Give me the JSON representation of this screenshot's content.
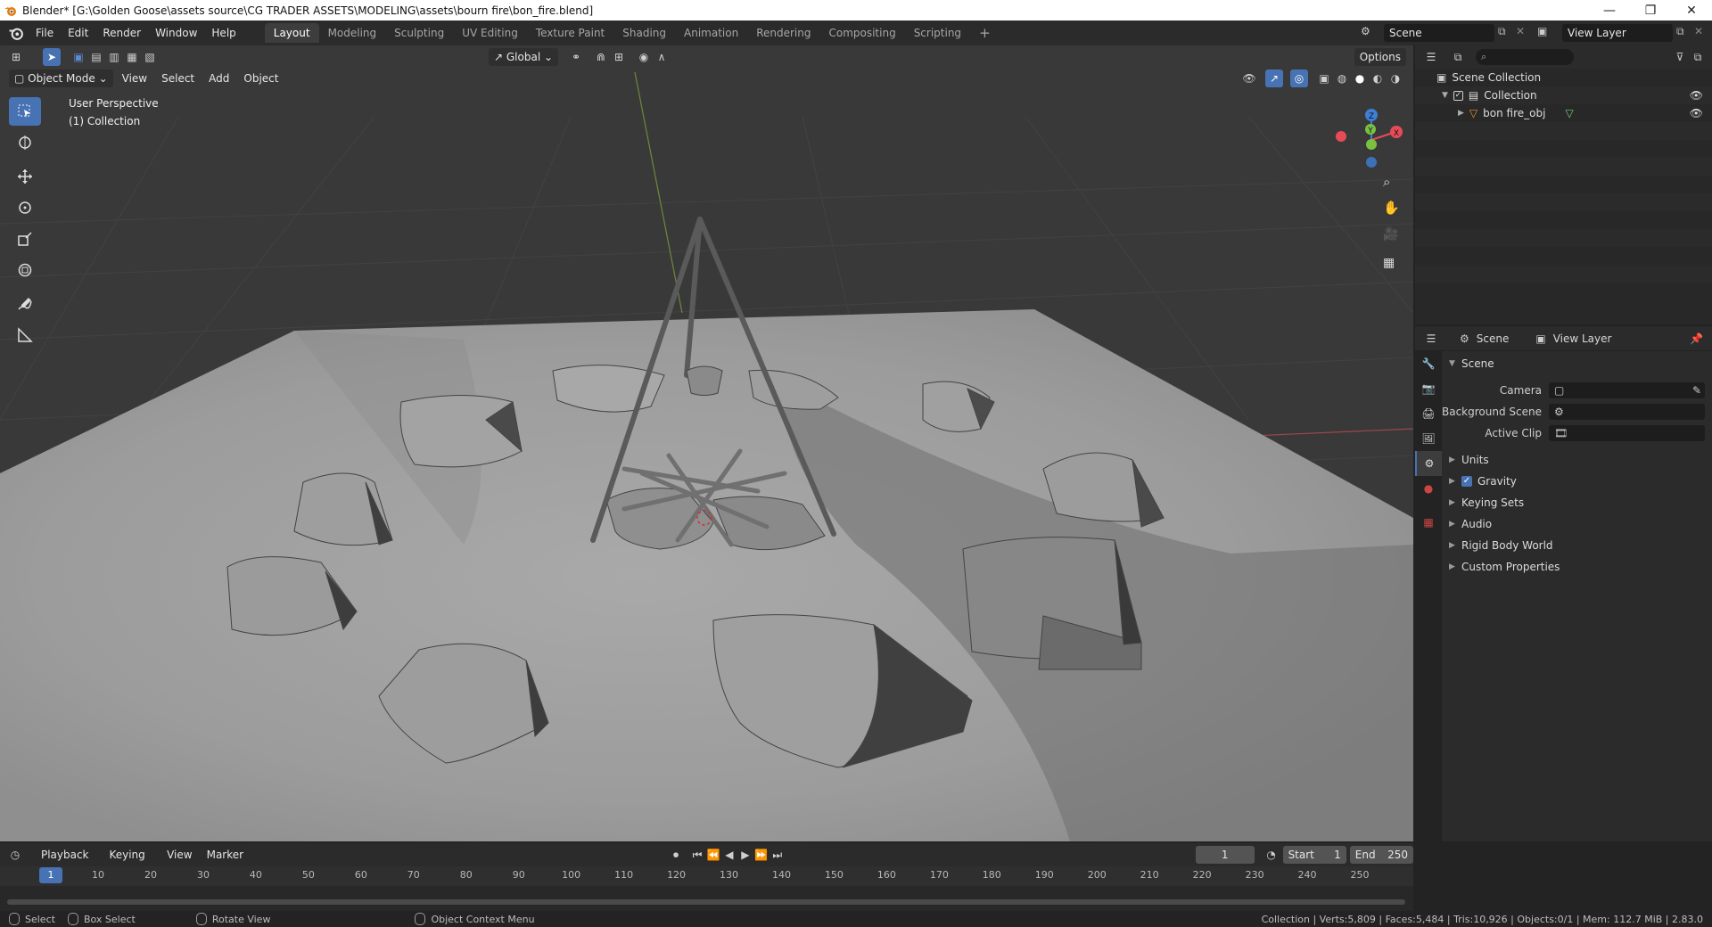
{
  "window": {
    "title": "Blender* [G:\\Golden Goose\\assets source\\CG TRADER ASSETS\\MODELING\\assets\\bourn fire\\bon_fire.blend]",
    "controls": [
      "—",
      "❐",
      "✕"
    ]
  },
  "menu": [
    "File",
    "Edit",
    "Render",
    "Window",
    "Help"
  ],
  "workspaces": [
    "Layout",
    "Modeling",
    "Sculpting",
    "UV Editing",
    "Texture Paint",
    "Shading",
    "Animation",
    "Rendering",
    "Compositing",
    "Scripting"
  ],
  "active_workspace": "Layout",
  "add_workspace": "+",
  "scene_selector": {
    "label": "Scene",
    "view_layer": "View Layer"
  },
  "viewport": {
    "mode": "Object Mode",
    "menus": [
      "View",
      "Select",
      "Add",
      "Object"
    ],
    "orientation": "Global",
    "options": "Options",
    "perspective_label": "User Perspective",
    "collection_label": "(1) Collection",
    "gizmo_axes": {
      "x": "X",
      "y": "Y",
      "z": "Z"
    },
    "axis_colors": {
      "x": "#e84b58",
      "y": "#7ac142",
      "z": "#3f7fd6"
    }
  },
  "outliner": {
    "rows": [
      {
        "label": "Scene Collection"
      },
      {
        "label": "Collection"
      },
      {
        "label": "bon fire_obj"
      }
    ]
  },
  "properties": {
    "tabs_header": {
      "scene": "Scene",
      "view_layer": "View Layer"
    },
    "section": "Scene",
    "fields": [
      {
        "label": "Camera"
      },
      {
        "label": "Background Scene"
      },
      {
        "label": "Active Clip"
      }
    ],
    "panels": [
      "Units",
      "Gravity",
      "Keying Sets",
      "Audio",
      "Rigid Body World",
      "Custom Properties"
    ],
    "gravity_checked": true
  },
  "timeline": {
    "menus": [
      "Playback",
      "Keying",
      "View",
      "Marker"
    ],
    "current_frame": "1",
    "start_label": "Start",
    "start": "1",
    "end_label": "End",
    "end": "250",
    "ticks": [
      "1",
      "10",
      "20",
      "30",
      "40",
      "50",
      "60",
      "70",
      "80",
      "90",
      "100",
      "110",
      "120",
      "130",
      "140",
      "150",
      "160",
      "170",
      "180",
      "190",
      "200",
      "210",
      "220",
      "230",
      "240",
      "250"
    ]
  },
  "statusbar": {
    "select": "Select",
    "box_select": "Box Select",
    "rotate_view": "Rotate View",
    "context_menu": "Object Context Menu",
    "stats": "Collection | Verts:5,809 | Faces:5,484 | Tris:10,926 | Objects:0/1 | Mem: 112.7 MiB | 2.83.0"
  },
  "colors": {
    "accent": "#4772b3",
    "bg": "#393939"
  }
}
